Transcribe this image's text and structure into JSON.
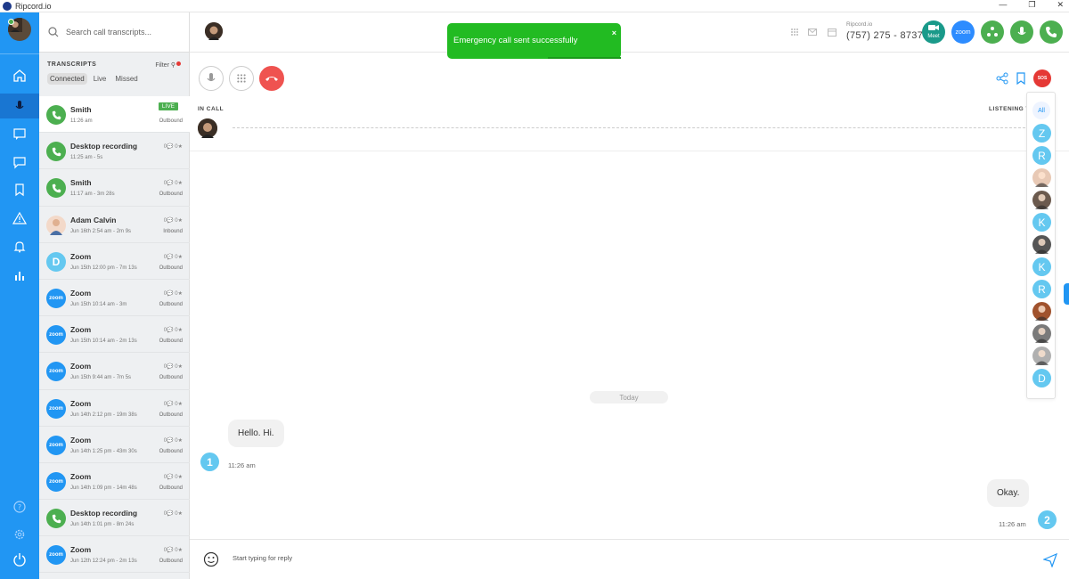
{
  "window": {
    "title": "Ripcord.io",
    "controls": [
      "—",
      "❐",
      "✕"
    ]
  },
  "search": {
    "placeholder": "Search call transcripts..."
  },
  "transcripts": {
    "heading": "TRANSCRIPTS",
    "filter_label": "Filter",
    "tabs": [
      "Connected",
      "Live",
      "Missed"
    ],
    "items": [
      {
        "name": "Smith",
        "sub": "11:26 am",
        "direction": "Outbound",
        "live": "LIVE",
        "icon": "phone-icon"
      },
      {
        "name": "Desktop recording",
        "sub": "11:25 am - 5s",
        "counts": "0💬 0★",
        "icon": "phone-icon"
      },
      {
        "name": "Smith",
        "sub": "11:17 am - 3m 28s",
        "direction": "Outbound",
        "counts": "0💬 0★",
        "icon": "phone-icon"
      },
      {
        "name": "Adam Calvin",
        "sub": "Jun 16th 2:54 am - 2m 9s",
        "direction": "Inbound",
        "counts": "0💬 0★",
        "icon": "avatar"
      },
      {
        "name": "Zoom",
        "sub": "Jun 15th 12:00 pm - 7m 13s",
        "direction": "Outbound",
        "counts": "0💬 0★",
        "icon": "letter-d",
        "letter": "D"
      },
      {
        "name": "Zoom",
        "sub": "Jun 15th 10:14 am - 3m",
        "direction": "Outbound",
        "counts": "0💬 0★",
        "icon": "zoom-icon",
        "logo": "zoom"
      },
      {
        "name": "Zoom",
        "sub": "Jun 15th 10:14 am - 2m 13s",
        "direction": "Outbound",
        "counts": "0💬 0★",
        "icon": "zoom-icon",
        "logo": "zoom"
      },
      {
        "name": "Zoom",
        "sub": "Jun 15th 9:44 am - 7m 5s",
        "direction": "Outbound",
        "counts": "0💬 0★",
        "icon": "zoom-icon",
        "logo": "zoom"
      },
      {
        "name": "Zoom",
        "sub": "Jun 14th 2:12 pm - 19m 38s",
        "direction": "Outbound",
        "counts": "0💬 0★",
        "icon": "zoom-icon",
        "logo": "zoom"
      },
      {
        "name": "Zoom",
        "sub": "Jun 14th 1:25 pm - 43m 30s",
        "direction": "Outbound",
        "counts": "0💬 0★",
        "icon": "zoom-icon",
        "logo": "zoom"
      },
      {
        "name": "Zoom",
        "sub": "Jun 14th 1:09 pm - 14m 48s",
        "direction": "Outbound",
        "counts": "0💬 0★",
        "icon": "zoom-icon",
        "logo": "zoom"
      },
      {
        "name": "Desktop recording",
        "sub": "Jun 14th 1:01 pm - 8m 24s",
        "counts": "0💬 0★",
        "icon": "phone-icon"
      },
      {
        "name": "Zoom",
        "sub": "Jun 12th 12:24 pm - 2m 13s",
        "direction": "Outbound",
        "counts": "0💬 0★",
        "icon": "zoom-icon",
        "logo": "zoom"
      }
    ]
  },
  "header": {
    "brand": "Ripcord.io",
    "phone": "(757) 275 - 8737",
    "meet_label": "Meet",
    "zoom_label": "zoom"
  },
  "call": {
    "in_call_label": "IN CALL",
    "listening_label": "LISTENING T",
    "sos_label": "SOS"
  },
  "participants": {
    "all_label": "All",
    "list": [
      {
        "type": "letter",
        "letter": "Z"
      },
      {
        "type": "letter",
        "letter": "R"
      },
      {
        "type": "photo",
        "color": "#e8c9b5"
      },
      {
        "type": "photo",
        "color": "#6b5a4e"
      },
      {
        "type": "letter",
        "letter": "K"
      },
      {
        "type": "photo",
        "color": "#555555"
      },
      {
        "type": "letter",
        "letter": "K"
      },
      {
        "type": "letter",
        "letter": "R"
      },
      {
        "type": "photo",
        "color": "#a0522d"
      },
      {
        "type": "photo",
        "color": "#7a7a7a"
      },
      {
        "type": "photo",
        "color": "#b0b0b0"
      },
      {
        "type": "letter",
        "letter": "D"
      }
    ]
  },
  "chat": {
    "day_label": "Today",
    "messages": [
      {
        "text": "Hello. Hi.",
        "time": "11:26 am",
        "speaker": "1"
      },
      {
        "text": "Okay.",
        "time": "11:26 am",
        "speaker": "2"
      }
    ]
  },
  "composer": {
    "placeholder": "Start typing for reply"
  },
  "toast": {
    "text": "Emergency call sent successfully",
    "close": "×"
  },
  "colors": {
    "accent": "#2196f3",
    "success": "#4caf50",
    "danger": "#e53935",
    "toast": "#22bb22",
    "participant_letter": "#64c8f0"
  }
}
